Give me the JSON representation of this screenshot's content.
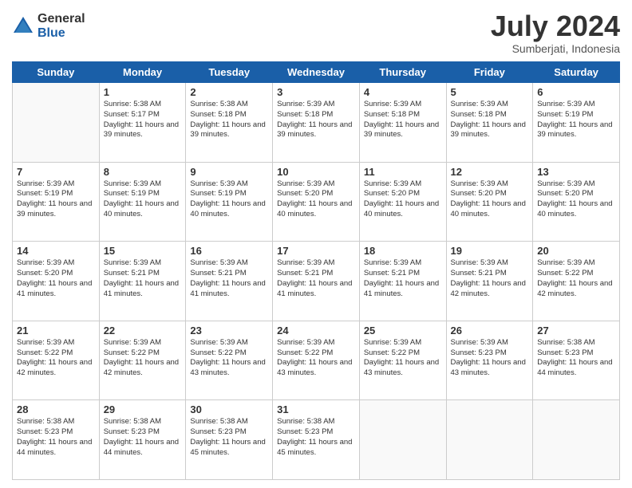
{
  "logo": {
    "general": "General",
    "blue": "Blue"
  },
  "header": {
    "month": "July 2024",
    "location": "Sumberjati, Indonesia"
  },
  "weekdays": [
    "Sunday",
    "Monday",
    "Tuesday",
    "Wednesday",
    "Thursday",
    "Friday",
    "Saturday"
  ],
  "weeks": [
    [
      {
        "day": "",
        "sunrise": "",
        "sunset": "",
        "daylight": "",
        "empty": true
      },
      {
        "day": "1",
        "sunrise": "Sunrise: 5:38 AM",
        "sunset": "Sunset: 5:17 PM",
        "daylight": "Daylight: 11 hours and 39 minutes."
      },
      {
        "day": "2",
        "sunrise": "Sunrise: 5:38 AM",
        "sunset": "Sunset: 5:18 PM",
        "daylight": "Daylight: 11 hours and 39 minutes."
      },
      {
        "day": "3",
        "sunrise": "Sunrise: 5:39 AM",
        "sunset": "Sunset: 5:18 PM",
        "daylight": "Daylight: 11 hours and 39 minutes."
      },
      {
        "day": "4",
        "sunrise": "Sunrise: 5:39 AM",
        "sunset": "Sunset: 5:18 PM",
        "daylight": "Daylight: 11 hours and 39 minutes."
      },
      {
        "day": "5",
        "sunrise": "Sunrise: 5:39 AM",
        "sunset": "Sunset: 5:18 PM",
        "daylight": "Daylight: 11 hours and 39 minutes."
      },
      {
        "day": "6",
        "sunrise": "Sunrise: 5:39 AM",
        "sunset": "Sunset: 5:19 PM",
        "daylight": "Daylight: 11 hours and 39 minutes."
      }
    ],
    [
      {
        "day": "7",
        "sunrise": "Sunrise: 5:39 AM",
        "sunset": "Sunset: 5:19 PM",
        "daylight": "Daylight: 11 hours and 39 minutes."
      },
      {
        "day": "8",
        "sunrise": "Sunrise: 5:39 AM",
        "sunset": "Sunset: 5:19 PM",
        "daylight": "Daylight: 11 hours and 40 minutes."
      },
      {
        "day": "9",
        "sunrise": "Sunrise: 5:39 AM",
        "sunset": "Sunset: 5:19 PM",
        "daylight": "Daylight: 11 hours and 40 minutes."
      },
      {
        "day": "10",
        "sunrise": "Sunrise: 5:39 AM",
        "sunset": "Sunset: 5:20 PM",
        "daylight": "Daylight: 11 hours and 40 minutes."
      },
      {
        "day": "11",
        "sunrise": "Sunrise: 5:39 AM",
        "sunset": "Sunset: 5:20 PM",
        "daylight": "Daylight: 11 hours and 40 minutes."
      },
      {
        "day": "12",
        "sunrise": "Sunrise: 5:39 AM",
        "sunset": "Sunset: 5:20 PM",
        "daylight": "Daylight: 11 hours and 40 minutes."
      },
      {
        "day": "13",
        "sunrise": "Sunrise: 5:39 AM",
        "sunset": "Sunset: 5:20 PM",
        "daylight": "Daylight: 11 hours and 40 minutes."
      }
    ],
    [
      {
        "day": "14",
        "sunrise": "Sunrise: 5:39 AM",
        "sunset": "Sunset: 5:20 PM",
        "daylight": "Daylight: 11 hours and 41 minutes."
      },
      {
        "day": "15",
        "sunrise": "Sunrise: 5:39 AM",
        "sunset": "Sunset: 5:21 PM",
        "daylight": "Daylight: 11 hours and 41 minutes."
      },
      {
        "day": "16",
        "sunrise": "Sunrise: 5:39 AM",
        "sunset": "Sunset: 5:21 PM",
        "daylight": "Daylight: 11 hours and 41 minutes."
      },
      {
        "day": "17",
        "sunrise": "Sunrise: 5:39 AM",
        "sunset": "Sunset: 5:21 PM",
        "daylight": "Daylight: 11 hours and 41 minutes."
      },
      {
        "day": "18",
        "sunrise": "Sunrise: 5:39 AM",
        "sunset": "Sunset: 5:21 PM",
        "daylight": "Daylight: 11 hours and 41 minutes."
      },
      {
        "day": "19",
        "sunrise": "Sunrise: 5:39 AM",
        "sunset": "Sunset: 5:21 PM",
        "daylight": "Daylight: 11 hours and 42 minutes."
      },
      {
        "day": "20",
        "sunrise": "Sunrise: 5:39 AM",
        "sunset": "Sunset: 5:22 PM",
        "daylight": "Daylight: 11 hours and 42 minutes."
      }
    ],
    [
      {
        "day": "21",
        "sunrise": "Sunrise: 5:39 AM",
        "sunset": "Sunset: 5:22 PM",
        "daylight": "Daylight: 11 hours and 42 minutes."
      },
      {
        "day": "22",
        "sunrise": "Sunrise: 5:39 AM",
        "sunset": "Sunset: 5:22 PM",
        "daylight": "Daylight: 11 hours and 42 minutes."
      },
      {
        "day": "23",
        "sunrise": "Sunrise: 5:39 AM",
        "sunset": "Sunset: 5:22 PM",
        "daylight": "Daylight: 11 hours and 43 minutes."
      },
      {
        "day": "24",
        "sunrise": "Sunrise: 5:39 AM",
        "sunset": "Sunset: 5:22 PM",
        "daylight": "Daylight: 11 hours and 43 minutes."
      },
      {
        "day": "25",
        "sunrise": "Sunrise: 5:39 AM",
        "sunset": "Sunset: 5:22 PM",
        "daylight": "Daylight: 11 hours and 43 minutes."
      },
      {
        "day": "26",
        "sunrise": "Sunrise: 5:39 AM",
        "sunset": "Sunset: 5:23 PM",
        "daylight": "Daylight: 11 hours and 43 minutes."
      },
      {
        "day": "27",
        "sunrise": "Sunrise: 5:38 AM",
        "sunset": "Sunset: 5:23 PM",
        "daylight": "Daylight: 11 hours and 44 minutes."
      }
    ],
    [
      {
        "day": "28",
        "sunrise": "Sunrise: 5:38 AM",
        "sunset": "Sunset: 5:23 PM",
        "daylight": "Daylight: 11 hours and 44 minutes."
      },
      {
        "day": "29",
        "sunrise": "Sunrise: 5:38 AM",
        "sunset": "Sunset: 5:23 PM",
        "daylight": "Daylight: 11 hours and 44 minutes."
      },
      {
        "day": "30",
        "sunrise": "Sunrise: 5:38 AM",
        "sunset": "Sunset: 5:23 PM",
        "daylight": "Daylight: 11 hours and 45 minutes."
      },
      {
        "day": "31",
        "sunrise": "Sunrise: 5:38 AM",
        "sunset": "Sunset: 5:23 PM",
        "daylight": "Daylight: 11 hours and 45 minutes."
      },
      {
        "day": "",
        "sunrise": "",
        "sunset": "",
        "daylight": "",
        "empty": true
      },
      {
        "day": "",
        "sunrise": "",
        "sunset": "",
        "daylight": "",
        "empty": true
      },
      {
        "day": "",
        "sunrise": "",
        "sunset": "",
        "daylight": "",
        "empty": true
      }
    ]
  ]
}
